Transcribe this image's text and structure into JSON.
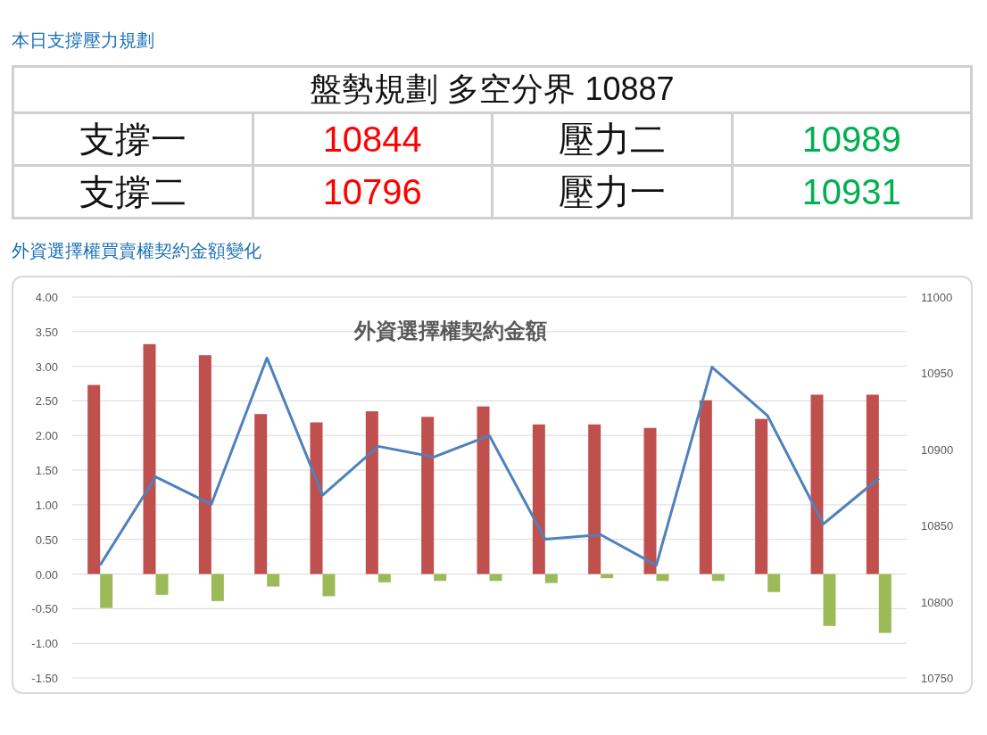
{
  "heading": "本日支撐壓力規劃",
  "table": {
    "title": "盤勢規劃 多空分界 10887",
    "rows": [
      {
        "cells": [
          {
            "text": "支撐一"
          },
          {
            "text": "10844",
            "color": "#ff0000"
          },
          {
            "text": "壓力二"
          },
          {
            "text": "10989",
            "color": "#00b050"
          }
        ]
      },
      {
        "cells": [
          {
            "text": "支撐二"
          },
          {
            "text": "10796",
            "color": "#ff0000"
          },
          {
            "text": "壓力一"
          },
          {
            "text": "10931",
            "color": "#00b050"
          }
        ]
      }
    ]
  },
  "chart_section": {
    "heading": "外資選擇權買賣權契約金額變化",
    "chart_data": {
      "type": "bar",
      "title": "外資選擇權契約金額",
      "grid": true,
      "ylim": [
        -1.5,
        4
      ],
      "yticks": [
        {
          "value": 4,
          "label": "4.00"
        },
        {
          "value": 3.5,
          "label": "3.50"
        },
        {
          "value": 3,
          "label": "3.00"
        },
        {
          "value": 2.5,
          "label": "2.50"
        },
        {
          "value": 2,
          "label": "2.00"
        },
        {
          "value": 1.5,
          "label": "1.50"
        },
        {
          "value": 1,
          "label": "1.00"
        },
        {
          "value": 0.5,
          "label": "0.50"
        },
        {
          "value": 0,
          "label": "0.00"
        },
        {
          "value": -0.5,
          "label": "-0.50"
        },
        {
          "value": -1,
          "label": "-1.00"
        },
        {
          "value": -1.5,
          "label": "-1.50"
        }
      ],
      "y2lim": [
        10750,
        11000
      ],
      "y2ticks": [
        11000,
        10950,
        10900,
        10850,
        10800,
        10750
      ],
      "series": [
        {
          "color": "#c0504d",
          "values": [
            2.73,
            3.32,
            3.16,
            2.31,
            2.19,
            2.35,
            2.27,
            2.42,
            2.16,
            2.16,
            2.11,
            2.51,
            2.24,
            2.59,
            2.59
          ]
        },
        {
          "color": "#9bbb59",
          "values": [
            -0.49,
            -0.3,
            -0.39,
            -0.18,
            -0.32,
            -0.12,
            -0.1,
            -0.1,
            -0.13,
            -0.06,
            -0.1,
            -0.1,
            -0.26,
            -0.75,
            -0.85
          ]
        },
        {
          "type": "line",
          "axis": "y2",
          "color": "#4f81bd",
          "values": [
            10824,
            10882,
            10864,
            10960,
            10870,
            10902,
            10895,
            10909,
            10841,
            10844,
            10824,
            10954,
            10922,
            10851,
            10881
          ]
        }
      ]
    }
  }
}
